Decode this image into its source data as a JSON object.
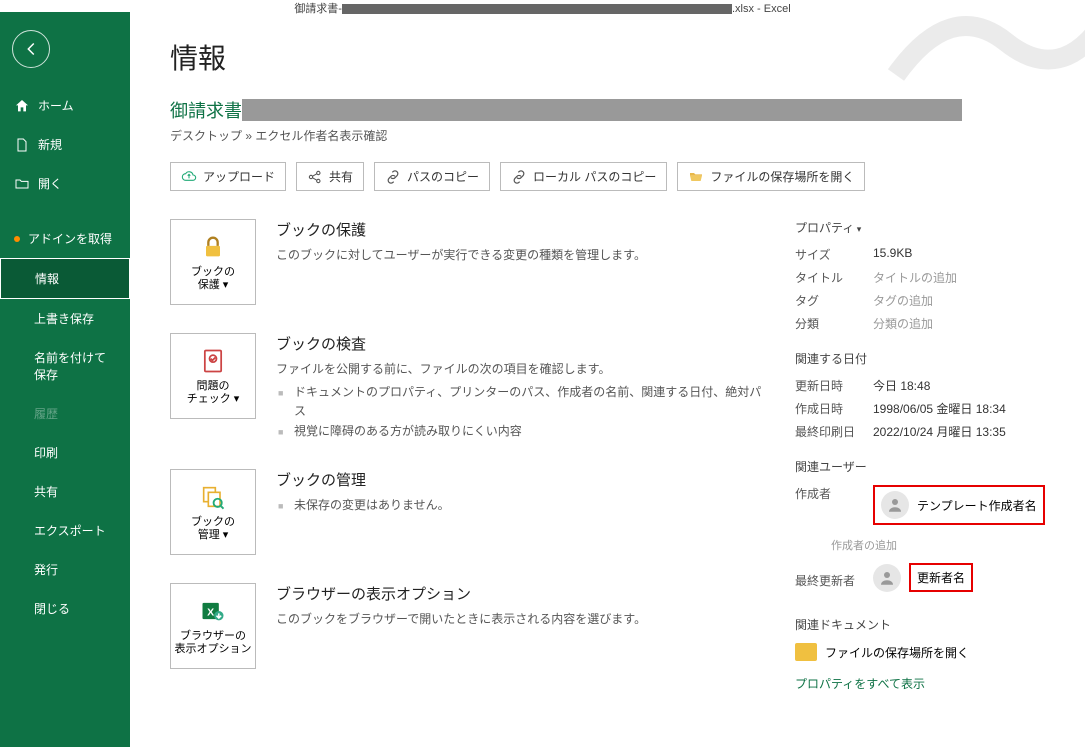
{
  "titlebar": {
    "prefix": "御請求書-",
    "suffix": ".xlsx  -  Excel"
  },
  "page": {
    "title": "情報"
  },
  "document": {
    "title_prefix": "御請求書",
    "breadcrumb": "デスクトップ » エクセル作者名表示確認"
  },
  "sidebar": {
    "home": "ホーム",
    "new": "新規",
    "open": "開く",
    "addin": "アドインを取得",
    "info": "情報",
    "save": "上書き保存",
    "saveas": "名前を付けて保存",
    "history": "履歴",
    "print": "印刷",
    "share": "共有",
    "export": "エクスポート",
    "publish": "発行",
    "close": "閉じる"
  },
  "actions": {
    "upload": "アップロード",
    "share": "共有",
    "copypath": "パスのコピー",
    "copylocalpath": "ローカル パスのコピー",
    "openlocation": "ファイルの保存場所を開く"
  },
  "blocks": {
    "protect": {
      "btn": "ブックの\n保護 ▾",
      "title": "ブックの保護",
      "desc": "このブックに対してユーザーが実行できる変更の種類を管理します。"
    },
    "inspect": {
      "btn": "問題の\nチェック ▾",
      "title": "ブックの検査",
      "desc": "ファイルを公開する前に、ファイルの次の項目を確認します。",
      "items": [
        "ドキュメントのプロパティ、プリンターのパス、作成者の名前、関連する日付、絶対パス",
        "視覚に障碍のある方が読み取りにくい内容"
      ]
    },
    "manage": {
      "btn": "ブックの\n管理 ▾",
      "title": "ブックの管理",
      "desc": "未保存の変更はありません。"
    },
    "browser": {
      "btn": "ブラウザーの\n表示オプション",
      "title": "ブラウザーの表示オプション",
      "desc": "このブックをブラウザーで開いたときに表示される内容を選びます。"
    }
  },
  "properties": {
    "header": "プロパティ",
    "size_label": "サイズ",
    "size_value": "15.9KB",
    "title_label": "タイトル",
    "title_value": "タイトルの追加",
    "tag_label": "タグ",
    "tag_value": "タグの追加",
    "category_label": "分類",
    "category_value": "分類の追加",
    "dates_header": "関連する日付",
    "modified_label": "更新日時",
    "modified_value": "今日 18:48",
    "created_label": "作成日時",
    "created_value": "1998/06/05 金曜日 18:34",
    "printed_label": "最終印刷日",
    "printed_value": "2022/10/24 月曜日 13:35",
    "users_header": "関連ユーザー",
    "author_label": "作成者",
    "author_value": "テンプレート作成者名",
    "add_author": "作成者の追加",
    "lastmod_label": "最終更新者",
    "lastmod_value": "更新者名",
    "docs_header": "関連ドキュメント",
    "open_location": "ファイルの保存場所を開く",
    "show_all": "プロパティをすべて表示"
  }
}
